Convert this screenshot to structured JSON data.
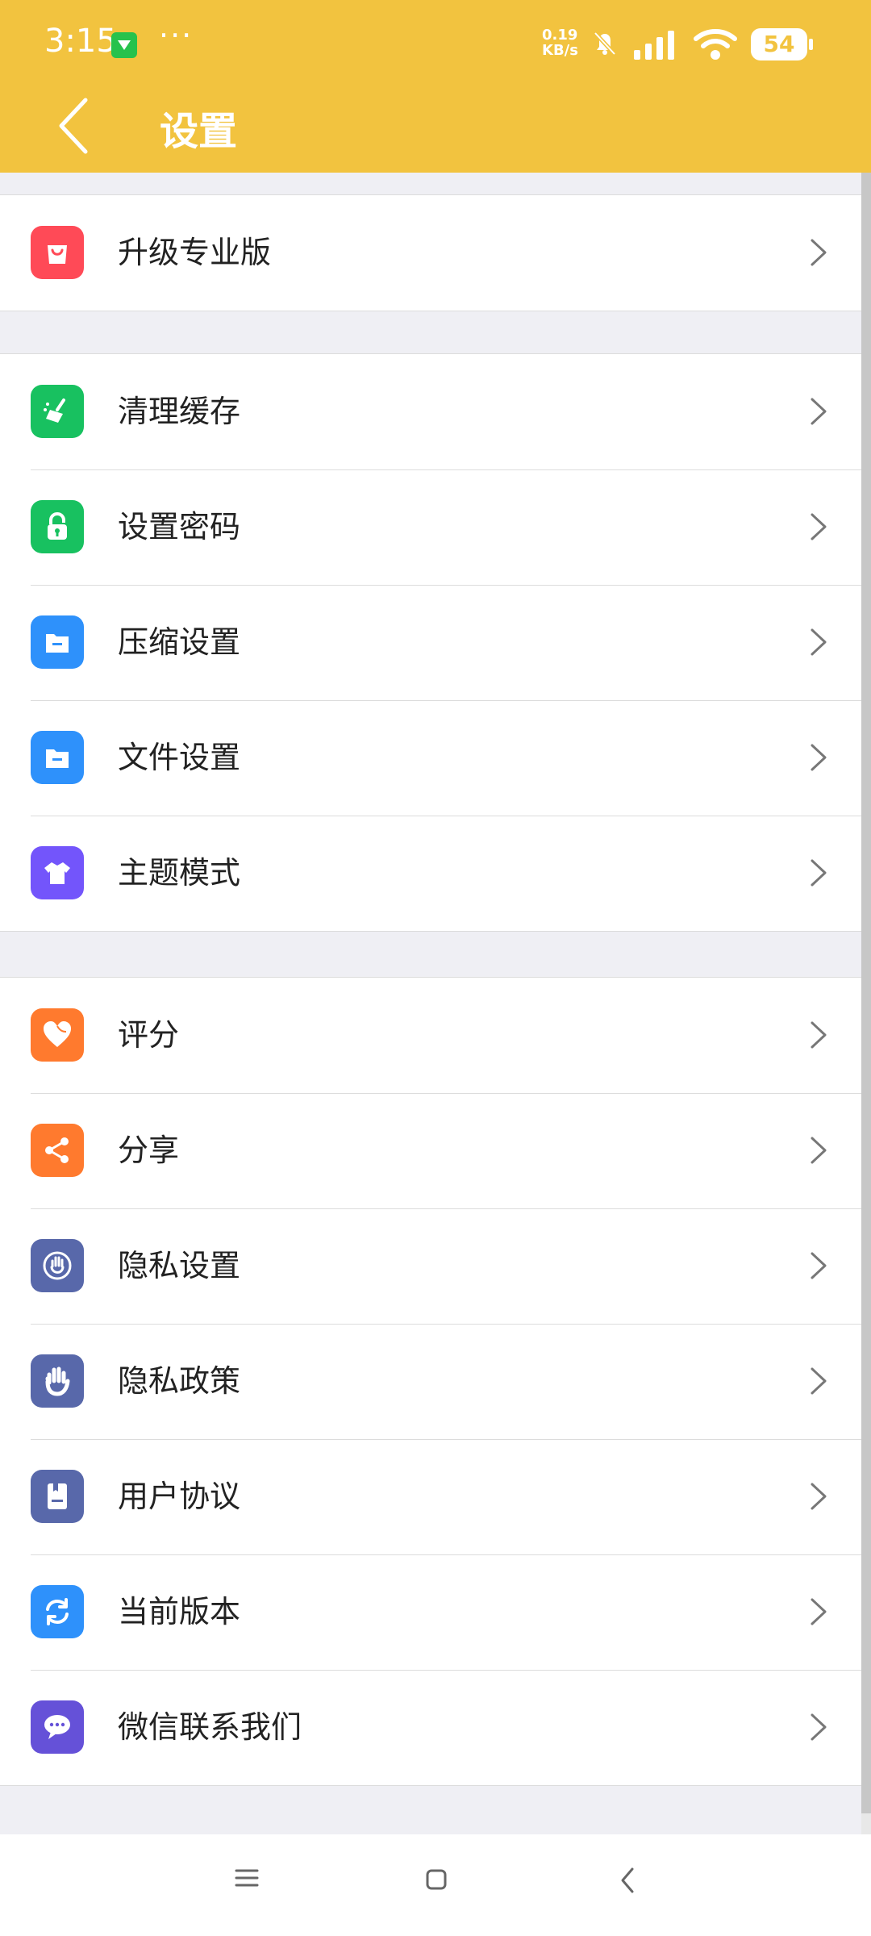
{
  "status_bar": {
    "time": "3:15",
    "dots": "···",
    "net_speed_value": "0.19",
    "net_speed_unit": "KB/s",
    "battery": "54"
  },
  "header": {
    "title": "设置"
  },
  "groups": [
    {
      "items": [
        {
          "label": "升级专业版",
          "icon": "shopping-bag-icon",
          "color": "#ff4a57"
        }
      ]
    },
    {
      "items": [
        {
          "label": "清理缓存",
          "icon": "broom-icon",
          "color": "#18c160"
        },
        {
          "label": "设置密码",
          "icon": "lock-icon",
          "color": "#18c160"
        },
        {
          "label": "压缩设置",
          "icon": "folder-icon",
          "color": "#2e91fb"
        },
        {
          "label": "文件设置",
          "icon": "folder-icon",
          "color": "#2e91fb"
        },
        {
          "label": "主题模式",
          "icon": "tshirt-icon",
          "color": "#7355fb"
        }
      ]
    },
    {
      "items": [
        {
          "label": "评分",
          "icon": "heart-icon",
          "color": "#ff7a2e"
        },
        {
          "label": "分享",
          "icon": "share-icon",
          "color": "#ff7a2e"
        },
        {
          "label": "隐私设置",
          "icon": "hand-icon",
          "color": "#5868aa"
        },
        {
          "label": "隐私政策",
          "icon": "hand-icon",
          "color": "#5868aa"
        },
        {
          "label": "用户协议",
          "icon": "document-icon",
          "color": "#5868aa"
        },
        {
          "label": "当前版本",
          "icon": "refresh-icon",
          "color": "#2e91fb"
        },
        {
          "label": "微信联系我们",
          "icon": "chat-icon",
          "color": "#6551d8"
        }
      ]
    }
  ],
  "colors": {
    "header_background": "#f2c33f",
    "page_background": "#efeff4"
  }
}
